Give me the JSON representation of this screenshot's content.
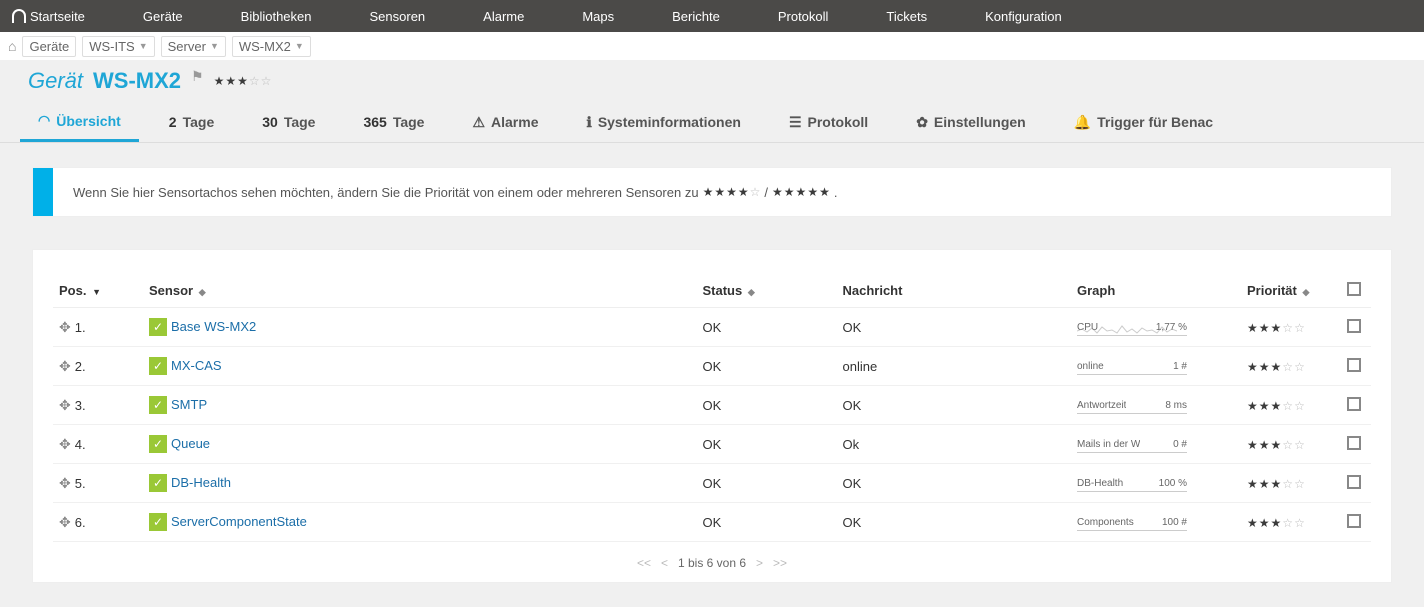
{
  "nav": [
    "Startseite",
    "Geräte",
    "Bibliotheken",
    "Sensoren",
    "Alarme",
    "Maps",
    "Berichte",
    "Protokoll",
    "Tickets",
    "Konfiguration"
  ],
  "breadcrumb": {
    "home": "⌂",
    "items": [
      {
        "label": "Geräte",
        "drop": false
      },
      {
        "label": "WS-ITS",
        "drop": true
      },
      {
        "label": "Server",
        "drop": true
      },
      {
        "label": "WS-MX2",
        "drop": true
      }
    ]
  },
  "title": {
    "prefix": "Gerät",
    "name": "WS-MX2",
    "priority_filled": 3,
    "priority_total": 5
  },
  "tabs": [
    {
      "icon": "◠",
      "label": "Übersicht",
      "active": true
    },
    {
      "num": "2",
      "label": "Tage"
    },
    {
      "num": "30",
      "label": "Tage"
    },
    {
      "num": "365",
      "label": "Tage"
    },
    {
      "icon": "⚠",
      "label": "Alarme"
    },
    {
      "icon": "ℹ",
      "label": "Systeminformationen"
    },
    {
      "icon": "☰",
      "label": "Protokoll"
    },
    {
      "icon": "✿",
      "label": "Einstellungen"
    },
    {
      "icon": "🔔",
      "label": "Trigger für Benac"
    }
  ],
  "notice": {
    "pre": "Wenn Sie hier Sensortachos sehen möchten, ändern Sie die Priorität von einem oder mehreren Sensoren zu",
    "mid": "/",
    "suf": "."
  },
  "columns": {
    "pos": "Pos.",
    "sensor": "Sensor",
    "status": "Status",
    "nachricht": "Nachricht",
    "graph": "Graph",
    "prio": "Priorität"
  },
  "rows": [
    {
      "pos": "1.",
      "sensor": "Base WS-MX2",
      "status": "OK",
      "msg": "OK",
      "gl": "CPU",
      "gv": "1,77 %",
      "spark": true
    },
    {
      "pos": "2.",
      "sensor": "MX-CAS",
      "status": "OK",
      "msg": "online",
      "gl": "online",
      "gv": "1 #",
      "spark": false
    },
    {
      "pos": "3.",
      "sensor": "SMTP",
      "status": "OK",
      "msg": "OK",
      "gl": "Antwortzeit",
      "gv": "8 ms",
      "spark": false
    },
    {
      "pos": "4.",
      "sensor": "Queue",
      "status": "OK",
      "msg": "Ok",
      "gl": "Mails in der W",
      "gv": "0 #",
      "spark": false
    },
    {
      "pos": "5.",
      "sensor": "DB-Health",
      "status": "OK",
      "msg": "OK",
      "gl": "DB-Health",
      "gv": "100 %",
      "spark": false
    },
    {
      "pos": "6.",
      "sensor": "ServerComponentState",
      "status": "OK",
      "msg": "OK",
      "gl": "Components",
      "gv": "100 #",
      "spark": false
    }
  ],
  "pager": {
    "first": "<<",
    "prev": "<",
    "text": "1 bis 6 von 6",
    "next": ">",
    "last": ">>"
  }
}
